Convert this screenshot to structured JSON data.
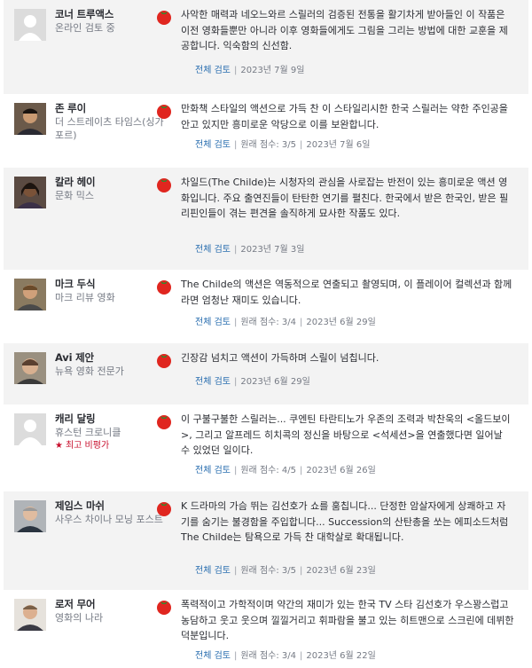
{
  "reviews": [
    {
      "critic": "코너 트루액스",
      "publication": "온라인 검토 중",
      "top_critic": "",
      "avatar": "placeholder",
      "quote": "사악한 매력과 네오느와르 스릴러의 검증된 전통을 활기차게 받아들인 이 작품은 이전 영화들뿐만 아니라 이후 영화들에게도 그림을 그리는 방법에 대한 교훈을 제공합니다. 익숙함의 신선함.",
      "full_review": "전체 검토",
      "score": "",
      "date": "2023년 7월 9일"
    },
    {
      "critic": "존 루이",
      "publication": "더 스트레이츠 타임스(싱가포르)",
      "top_critic": "",
      "avatar": "photo",
      "quote": "만화책 스타일의 액션으로 가득 찬 이 스타일리시한 한국 스릴러는 약한 주인공을 안고 있지만 흥미로운 악당으로 이를 보완합니다.",
      "full_review": "전체 검토",
      "score": "원래 점수: 3/5",
      "date": "2023년 7월 6일"
    },
    {
      "critic": "칼라 헤이",
      "publication": "문화 믹스",
      "top_critic": "",
      "avatar": "photo",
      "quote": "차일드(The Childe)는 시청자의 관심을 사로잡는 반전이 있는 흥미로운 액션 영화입니다. 주요 출연진들이 탄탄한 연기를 펼친다. 한국에서 받은 한국인, 받은 필리핀인들이 겪는 편견을 솔직하게 묘사한 작품도 있다.",
      "full_review": "전체 검토",
      "score": "",
      "date": "2023년 7월 3일"
    },
    {
      "critic": "마크 두식",
      "publication": "마크 리뷰 영화",
      "top_critic": "",
      "avatar": "photo",
      "quote": "The Childe의 액션은 역동적으로 연출되고 촬영되며, 이 플레이어 컬렉션과 함께라면 엄청난 재미도 있습니다.",
      "full_review": "전체 검토",
      "score": "원래 점수: 3/4",
      "date": "2023년 6월 29일"
    },
    {
      "critic": "Avi 제안",
      "publication": "뉴욕 영화 전문가",
      "top_critic": "",
      "avatar": "photo",
      "quote": "긴장감 넘치고 액션이 가득하며 스릴이 넘칩니다.",
      "full_review": "전체 검토",
      "score": "",
      "date": "2023년 6월 29일"
    },
    {
      "critic": "캐리 달링",
      "publication": "휴스턴 크로니클",
      "top_critic": "최고 비평가",
      "avatar": "placeholder",
      "quote": "이 구불구불한 스릴러는... 쿠엔틴 타란티노가 우존의 조력과 박찬욱의 <올드보이>, 그리고 알프레드 히치콕의 정신을 바탕으로 <석세션>을 연출했다면 일어날 수 있었던 일이다.",
      "full_review": "전체 검토",
      "score": "원래 점수: 4/5",
      "date": "2023년 6월 26일"
    },
    {
      "critic": "제임스 마쉬",
      "publication": "사우스 차이나 모닝 포스트",
      "top_critic": "",
      "avatar": "photo",
      "quote": "K 드라마의 가슴 뛰는 김선호가 쇼를 훔칩니다... 단정한 암살자에게 상쾌하고 자기를 숨기는 불경함을 주입합니다... Succession의 산탄총을 쏘는 에피소드처럼 The Childe는 탐욕으로 가득 찬 대학살로 확대됩니다.",
      "full_review": "전체 검토",
      "score": "원래 점수: 3/5",
      "date": "2023년 6월 23일"
    },
    {
      "critic": "로저 무어",
      "publication": "영화의 나라",
      "top_critic": "",
      "avatar": "photo",
      "quote": "폭력적이고 가학적이며 약간의 재미가 있는 한국 TV 스타 김선호가 우스꽝스럽고 농담하고 웃고 웃으며 낄낄거리고 휘파람을 불고 있는 히트맨으로 스크린에 데뷔한 덕분입니다.",
      "full_review": "전체 검토",
      "score": "원래 점수: 3/4",
      "date": "2023년 6월 22일"
    }
  ],
  "icons": {
    "fresh": "fresh-tomato-icon",
    "top_critic_star": "★"
  },
  "colors": {
    "link": "#2b6fb0",
    "tomato": "#e0261f",
    "top_critic": "#c8102e"
  }
}
